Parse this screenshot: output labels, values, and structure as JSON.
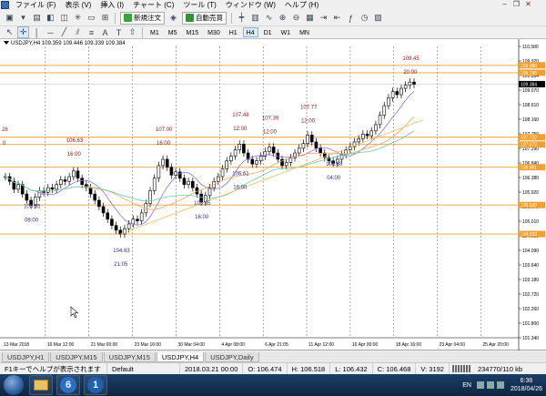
{
  "menu": [
    "ファイル (F)",
    "表示 (V)",
    "挿入 (I)",
    "チャート (C)",
    "ツール (T)",
    "ウィンドウ (W)",
    "ヘルプ (H)"
  ],
  "toolbar": {
    "new_order_label": "新規注文",
    "auto_trade_label": "自動売買"
  },
  "timeframes": [
    "M1",
    "M5",
    "M15",
    "M30",
    "H1",
    "H4",
    "D1",
    "W1",
    "MN"
  ],
  "active_timeframe": "H4",
  "chart": {
    "title": "USDJPY,H4  109.359 109.446 109.339 109.384",
    "bg": "#ffffff",
    "hline_color": "#f0a030",
    "annotation_color": "#8b1a1a",
    "low_annotation_color": "#303080",
    "candle_color": "#000000",
    "ma_fast_color": "#9370db",
    "ma_mid_color": "#f4a460",
    "ma_slow_color": "#66cdaa",
    "trend_color": "#f0c060",
    "price_labels": [
      "110.580",
      "109.920",
      "109.384",
      "109.070",
      "108.610",
      "108.160",
      "107.750",
      "107.290",
      "106.840",
      "106.380",
      "105.920",
      "105.470",
      "105.010",
      "104.550",
      "104.090",
      "103.640",
      "103.180",
      "102.720",
      "102.260",
      "101.800",
      "101.340"
    ],
    "ylim": [
      101.34,
      110.58
    ],
    "hlines": [
      {
        "price": 109.98,
        "label": "109.980"
      },
      {
        "price": 109.745,
        "label": "109.745"
      },
      {
        "price": 107.7,
        "label": "107.722"
      },
      {
        "price": 107.47,
        "label": "107.472"
      },
      {
        "price": 106.75,
        "label": "106.661"
      },
      {
        "price": 105.55,
        "label": "105.530"
      },
      {
        "price": 104.63,
        "label": "104.633"
      }
    ],
    "current_price": {
      "price": 109.384,
      "label": "109.384"
    },
    "x_labels": [
      "13 Mar 2018",
      "16 Mar 12:00",
      "21 Mar 00:00",
      "23 Mar 16:00",
      "30 Mar 04:00",
      "4 Apr 08:00",
      "6 Apr 21:05",
      "11 Apr 12:00",
      "16 Apr 00:00",
      "18 Apr 16:00",
      "23 Apr 04:00",
      "25 Apr 20:00"
    ],
    "annotations": [
      {
        "price_text": "28",
        "time_text": "0",
        "kind": "high"
      },
      {
        "price_text": "106.63",
        "time_text": "16:00",
        "kind": "high"
      },
      {
        "price_text": "107.00",
        "time_text": "16:00",
        "kind": "high"
      },
      {
        "price_text": "107.48",
        "time_text": "12:00",
        "kind": "high"
      },
      {
        "price_text": "107.39",
        "time_text": "12:00",
        "kind": "high"
      },
      {
        "price_text": "107.77",
        "time_text": "12:00",
        "kind": "high"
      },
      {
        "price_text": "109.45",
        "time_text": "20:00",
        "kind": "high"
      },
      {
        "price_text": "105.55",
        "time_text": "08:00",
        "kind": "low"
      },
      {
        "price_text": "104.63",
        "time_text": "21:05",
        "kind": "low"
      },
      {
        "price_text": "105.65",
        "time_text": "16:00",
        "kind": "low"
      },
      {
        "price_text": "106.61",
        "time_text": "16:00",
        "kind": "low"
      },
      {
        "price_text": "106.88",
        "time_text": "04:00",
        "kind": "low"
      }
    ]
  },
  "chart_data": {
    "type": "candlestick",
    "title": "USDJPY,H4",
    "ylim": [
      101.34,
      110.58
    ],
    "close": [
      106.45,
      106.3,
      106.05,
      106.2,
      105.9,
      105.7,
      105.55,
      105.8,
      106.0,
      105.95,
      106.1,
      106.05,
      106.2,
      106.35,
      106.3,
      106.45,
      106.63,
      106.4,
      106.2,
      106.1,
      105.9,
      105.7,
      105.5,
      105.3,
      105.1,
      104.9,
      104.75,
      104.63,
      104.8,
      104.95,
      105.1,
      105.05,
      105.3,
      105.6,
      106.0,
      106.4,
      106.8,
      107.0,
      106.75,
      106.5,
      106.6,
      106.4,
      106.2,
      106.3,
      106.1,
      105.9,
      105.65,
      105.85,
      106.1,
      106.3,
      106.45,
      106.7,
      106.95,
      107.1,
      107.3,
      107.48,
      107.2,
      107.0,
      106.85,
      106.95,
      107.1,
      107.25,
      107.39,
      107.2,
      107.0,
      106.8,
      106.9,
      107.05,
      107.2,
      107.35,
      107.5,
      107.77,
      107.55,
      107.35,
      107.2,
      107.05,
      106.95,
      106.88,
      107.0,
      107.15,
      107.3,
      107.4,
      107.55,
      107.65,
      107.8,
      107.75,
      107.9,
      108.1,
      108.4,
      108.7,
      108.95,
      109.15,
      109.05,
      109.25,
      109.35,
      109.45,
      109.38
    ],
    "series": [
      {
        "name": "MA fast"
      },
      {
        "name": "MA mid"
      },
      {
        "name": "MA slow"
      }
    ]
  },
  "tabs": [
    "USDJPY,H1",
    "USDJPY,M15",
    "USDJPY,M15",
    "USDJPY,H4",
    "USDJPY,Daily"
  ],
  "active_tab": 3,
  "status": {
    "help": "F1キーでヘルプが表示されます",
    "profile": "Default",
    "time": "2018.03.21 00:00",
    "open": "O: 106.474",
    "high": "H: 106.518",
    "low": "L: 106.432",
    "close": "C: 106.468",
    "volume": "V: 3192",
    "traffic": "234770/110 kb"
  },
  "taskbar": {
    "app1": "6",
    "app2": "1",
    "lang": "EN",
    "time": "6:36",
    "date": "2018/04/26"
  }
}
